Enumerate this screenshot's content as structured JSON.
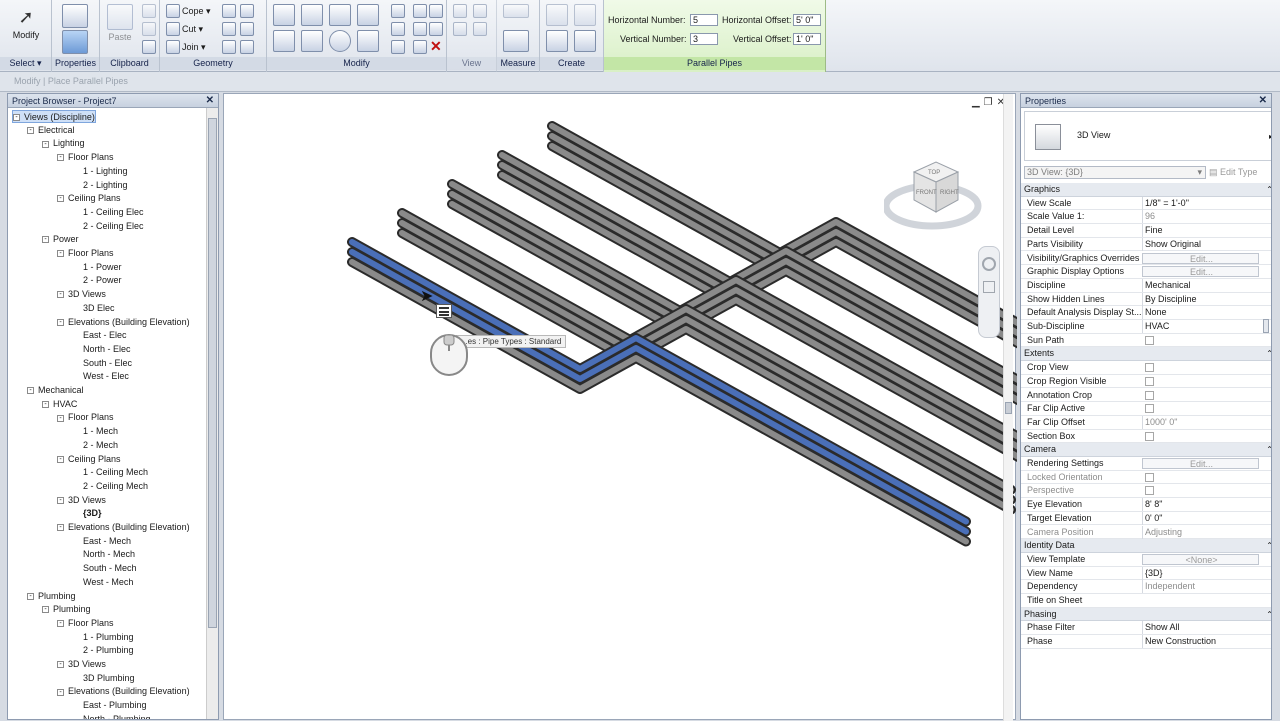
{
  "ribbon": {
    "groups": {
      "select": {
        "button": "Modify",
        "label": "Select"
      },
      "properties": {
        "label": "Properties"
      },
      "clipboard": {
        "paste": "Paste",
        "label": "Clipboard"
      },
      "geometry": {
        "cope": "Cope",
        "cut": "Cut",
        "join": "Join",
        "label": "Geometry"
      },
      "modify": {
        "label": "Modify"
      },
      "view": {
        "label": "View"
      },
      "measure": {
        "label": "Measure"
      },
      "create": {
        "label": "Create"
      }
    },
    "parallel_pipes": {
      "label": "Parallel Pipes",
      "horizontal_number_label": "Horizontal Number:",
      "horizontal_number_value": "5",
      "vertical_number_label": "Vertical Number:",
      "vertical_number_value": "3",
      "horizontal_offset_label": "Horizontal Offset:",
      "horizontal_offset_value": "5'  0\"",
      "vertical_offset_label": "Vertical Offset:",
      "vertical_offset_value": "1'  0\""
    }
  },
  "options_bar": {
    "text": "Modify | Place Parallel Pipes"
  },
  "project_browser": {
    "title": "Project Browser - Project7",
    "nodes": [
      {
        "label": "Views (Discipline)",
        "level": 0,
        "toggle": "-",
        "selected": true
      },
      {
        "label": "Electrical",
        "level": 1,
        "toggle": "-"
      },
      {
        "label": "Lighting",
        "level": 2,
        "toggle": "-"
      },
      {
        "label": "Floor Plans",
        "level": 3,
        "toggle": "-"
      },
      {
        "label": "1 - Lighting",
        "level": 4
      },
      {
        "label": "2 - Lighting",
        "level": 4
      },
      {
        "label": "Ceiling Plans",
        "level": 3,
        "toggle": "-"
      },
      {
        "label": "1 - Ceiling Elec",
        "level": 4
      },
      {
        "label": "2 - Ceiling Elec",
        "level": 4
      },
      {
        "label": "Power",
        "level": 2,
        "toggle": "-"
      },
      {
        "label": "Floor Plans",
        "level": 3,
        "toggle": "-"
      },
      {
        "label": "1 - Power",
        "level": 4
      },
      {
        "label": "2 - Power",
        "level": 4
      },
      {
        "label": "3D Views",
        "level": 3,
        "toggle": "-"
      },
      {
        "label": "3D Elec",
        "level": 4
      },
      {
        "label": "Elevations (Building Elevation)",
        "level": 3,
        "toggle": "-"
      },
      {
        "label": "East - Elec",
        "level": 4
      },
      {
        "label": "North - Elec",
        "level": 4
      },
      {
        "label": "South - Elec",
        "level": 4
      },
      {
        "label": "West - Elec",
        "level": 4
      },
      {
        "label": "Mechanical",
        "level": 1,
        "toggle": "-"
      },
      {
        "label": "HVAC",
        "level": 2,
        "toggle": "-"
      },
      {
        "label": "Floor Plans",
        "level": 3,
        "toggle": "-"
      },
      {
        "label": "1 - Mech",
        "level": 4
      },
      {
        "label": "2 - Mech",
        "level": 4
      },
      {
        "label": "Ceiling Plans",
        "level": 3,
        "toggle": "-"
      },
      {
        "label": "1 - Ceiling Mech",
        "level": 4
      },
      {
        "label": "2 - Ceiling Mech",
        "level": 4
      },
      {
        "label": "3D Views",
        "level": 3,
        "toggle": "-"
      },
      {
        "label": "{3D}",
        "level": 4,
        "bold": true
      },
      {
        "label": "Elevations (Building Elevation)",
        "level": 3,
        "toggle": "-"
      },
      {
        "label": "East - Mech",
        "level": 4
      },
      {
        "label": "North - Mech",
        "level": 4
      },
      {
        "label": "South - Mech",
        "level": 4
      },
      {
        "label": "West - Mech",
        "level": 4
      },
      {
        "label": "Plumbing",
        "level": 1,
        "toggle": "-"
      },
      {
        "label": "Plumbing",
        "level": 2,
        "toggle": "-"
      },
      {
        "label": "Floor Plans",
        "level": 3,
        "toggle": "-"
      },
      {
        "label": "1 - Plumbing",
        "level": 4
      },
      {
        "label": "2 - Plumbing",
        "level": 4
      },
      {
        "label": "3D Views",
        "level": 3,
        "toggle": "-"
      },
      {
        "label": "3D Plumbing",
        "level": 4
      },
      {
        "label": "Elevations (Building Elevation)",
        "level": 3,
        "toggle": "-"
      },
      {
        "label": "East - Plumbing",
        "level": 4
      },
      {
        "label": "North - Plumbing",
        "level": 4
      }
    ]
  },
  "canvas": {
    "tooltip": "...es : Pipe Types : Standard",
    "viewcube": {
      "top": "TOP",
      "front": "FRONT",
      "right": "RIGHT"
    }
  },
  "properties": {
    "title": "Properties",
    "type_name": "3D View",
    "view_selector": "3D View: {3D}",
    "edit_type": "Edit Type",
    "sections": [
      {
        "name": "Graphics",
        "rows": [
          {
            "name": "View Scale",
            "value": "1/8\" = 1'-0\""
          },
          {
            "name": "Scale Value    1:",
            "value": "96",
            "grey": true
          },
          {
            "name": "Detail Level",
            "value": "Fine"
          },
          {
            "name": "Parts Visibility",
            "value": "Show Original"
          },
          {
            "name": "Visibility/Graphics Overrides",
            "value": "Edit...",
            "button": true
          },
          {
            "name": "Graphic Display Options",
            "value": "Edit...",
            "button": true
          },
          {
            "name": "Discipline",
            "value": "Mechanical"
          },
          {
            "name": "Show Hidden Lines",
            "value": "By Discipline"
          },
          {
            "name": "Default Analysis Display St...",
            "value": "None"
          },
          {
            "name": "Sub-Discipline",
            "value": "HVAC"
          },
          {
            "name": "Sun Path",
            "value": "",
            "checkbox": true
          }
        ]
      },
      {
        "name": "Extents",
        "rows": [
          {
            "name": "Crop View",
            "value": "",
            "checkbox": true
          },
          {
            "name": "Crop Region Visible",
            "value": "",
            "checkbox": true
          },
          {
            "name": "Annotation Crop",
            "value": "",
            "checkbox": true
          },
          {
            "name": "Far Clip Active",
            "value": "",
            "checkbox": true
          },
          {
            "name": "Far Clip Offset",
            "value": "1000'  0\"",
            "grey": true
          },
          {
            "name": "Section Box",
            "value": "",
            "checkbox": true
          }
        ]
      },
      {
        "name": "Camera",
        "rows": [
          {
            "name": "Rendering Settings",
            "value": "Edit...",
            "button": true
          },
          {
            "name": "Locked Orientation",
            "value": "",
            "checkbox": true,
            "greyname": true
          },
          {
            "name": "Perspective",
            "value": "",
            "checkbox": true,
            "greyname": true
          },
          {
            "name": "Eye Elevation",
            "value": "8'  8\""
          },
          {
            "name": "Target Elevation",
            "value": "0'  0\""
          },
          {
            "name": "Camera Position",
            "value": "Adjusting",
            "grey": true,
            "greyname": true
          }
        ]
      },
      {
        "name": "Identity Data",
        "rows": [
          {
            "name": "View Template",
            "value": "<None>",
            "button": true
          },
          {
            "name": "View Name",
            "value": "{3D}"
          },
          {
            "name": "Dependency",
            "value": "Independent",
            "grey": true
          },
          {
            "name": "Title on Sheet",
            "value": ""
          }
        ]
      },
      {
        "name": "Phasing",
        "rows": [
          {
            "name": "Phase Filter",
            "value": "Show All"
          },
          {
            "name": "Phase",
            "value": "New Construction"
          }
        ]
      }
    ]
  }
}
